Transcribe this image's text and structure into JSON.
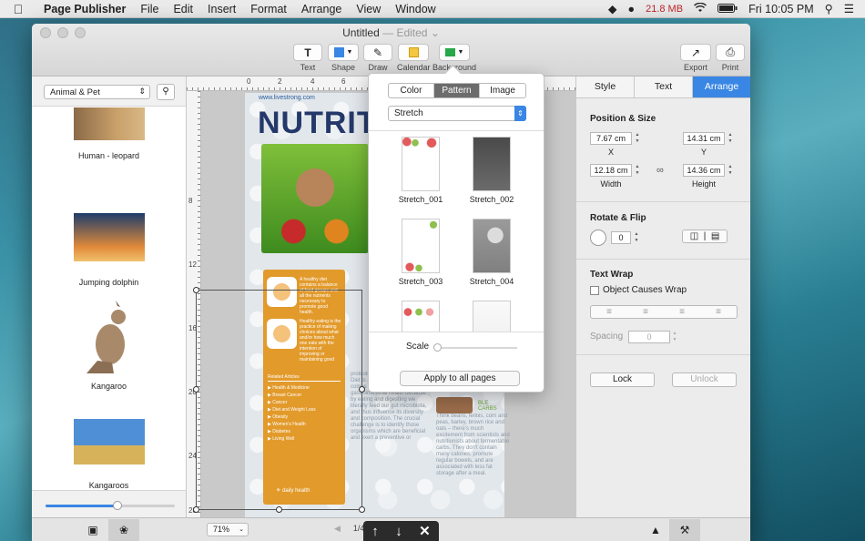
{
  "menubar": {
    "app_name": "Page Publisher",
    "items": [
      "File",
      "Edit",
      "Insert",
      "Format",
      "Arrange",
      "View",
      "Window"
    ],
    "memory": "21.8 MB",
    "clock": "Fri 10:05 PM"
  },
  "window": {
    "title": "Untitled",
    "edited": "— Edited",
    "toolbar": {
      "text": "Text",
      "shape": "Shape",
      "draw": "Draw",
      "calendar": "Calendar",
      "background": "Background",
      "export": "Export",
      "print": "Print"
    }
  },
  "sidebar": {
    "category": "Animal & Pet",
    "items": [
      "Human - leopard",
      "Jumping dolphin",
      "Kangaroo",
      "Kangaroos"
    ],
    "zoom_fraction": 0.56
  },
  "page_content": {
    "url": "www.livestrong.com",
    "headline": "NUTRIT",
    "orange_text_1": "A healthy diet contains a balance of food groups and all the nutrients necessary to promote good health.",
    "orange_text_2": "Healthy eating is the practice of making choices about what and/or how much one eats with the intention of improving or maintaining good",
    "related_title": "Related Articles",
    "related_items": [
      "Health & Medicine",
      "Breast Cancer",
      "Cancer",
      "Diet and Weight Loss",
      "Obesity",
      "Women's Health",
      "Diabetes",
      "Living Well"
    ],
    "footer_brand": "daily health",
    "col1_text": "probiotics in the new future. Diet is a central issue when it comes to preserving our gastrointestinal health because by eating and digesting we literally feed our gut microbiota, and thus influence its diversity and composition. The crucial challenge is to identify those organisms which are beneficial and exert a preventive or",
    "col2_text": "Think beans, lentils, corn and peas, barley, brown rice and oats – there's much excitement from scientists and nutritionists about fermentable carbs. They don't contain many calories, promote regular bowels, and are associated with less fat storage after a meal.",
    "green_label": "BLE CARBS"
  },
  "background_popover": {
    "tabs": [
      "Color",
      "Pattern",
      "Image"
    ],
    "active_tab": "Pattern",
    "mode": "Stretch",
    "tiles": [
      "Stretch_001",
      "Stretch_002",
      "Stretch_003",
      "Stretch_004"
    ],
    "scale_label": "Scale",
    "scale_value": 0,
    "apply_label": "Apply to all pages"
  },
  "inspector": {
    "tabs": [
      "Style",
      "Text",
      "Arrange"
    ],
    "active_tab": "Arrange",
    "position_size_title": "Position & Size",
    "x_value": "7.67 cm",
    "x_label": "X",
    "y_value": "14.31 cm",
    "y_label": "Y",
    "width_value": "12.18 cm",
    "width_label": "Width",
    "height_value": "14.36 cm",
    "height_label": "Height",
    "rotate_title": "Rotate & Flip",
    "rotate_value": "0",
    "text_wrap_title": "Text Wrap",
    "wrap_checkbox": "Object Causes Wrap",
    "spacing_label": "Spacing",
    "spacing_value": "0",
    "lock_label": "Lock",
    "unlock_label": "Unlock"
  },
  "statusbar": {
    "zoom": "71%",
    "page_indicator": "1/4"
  },
  "colors": {
    "accent": "#3a86e4",
    "headline": "#24386a",
    "sidebar_orange": "#e29a2b",
    "memory_red": "#c0262b"
  }
}
